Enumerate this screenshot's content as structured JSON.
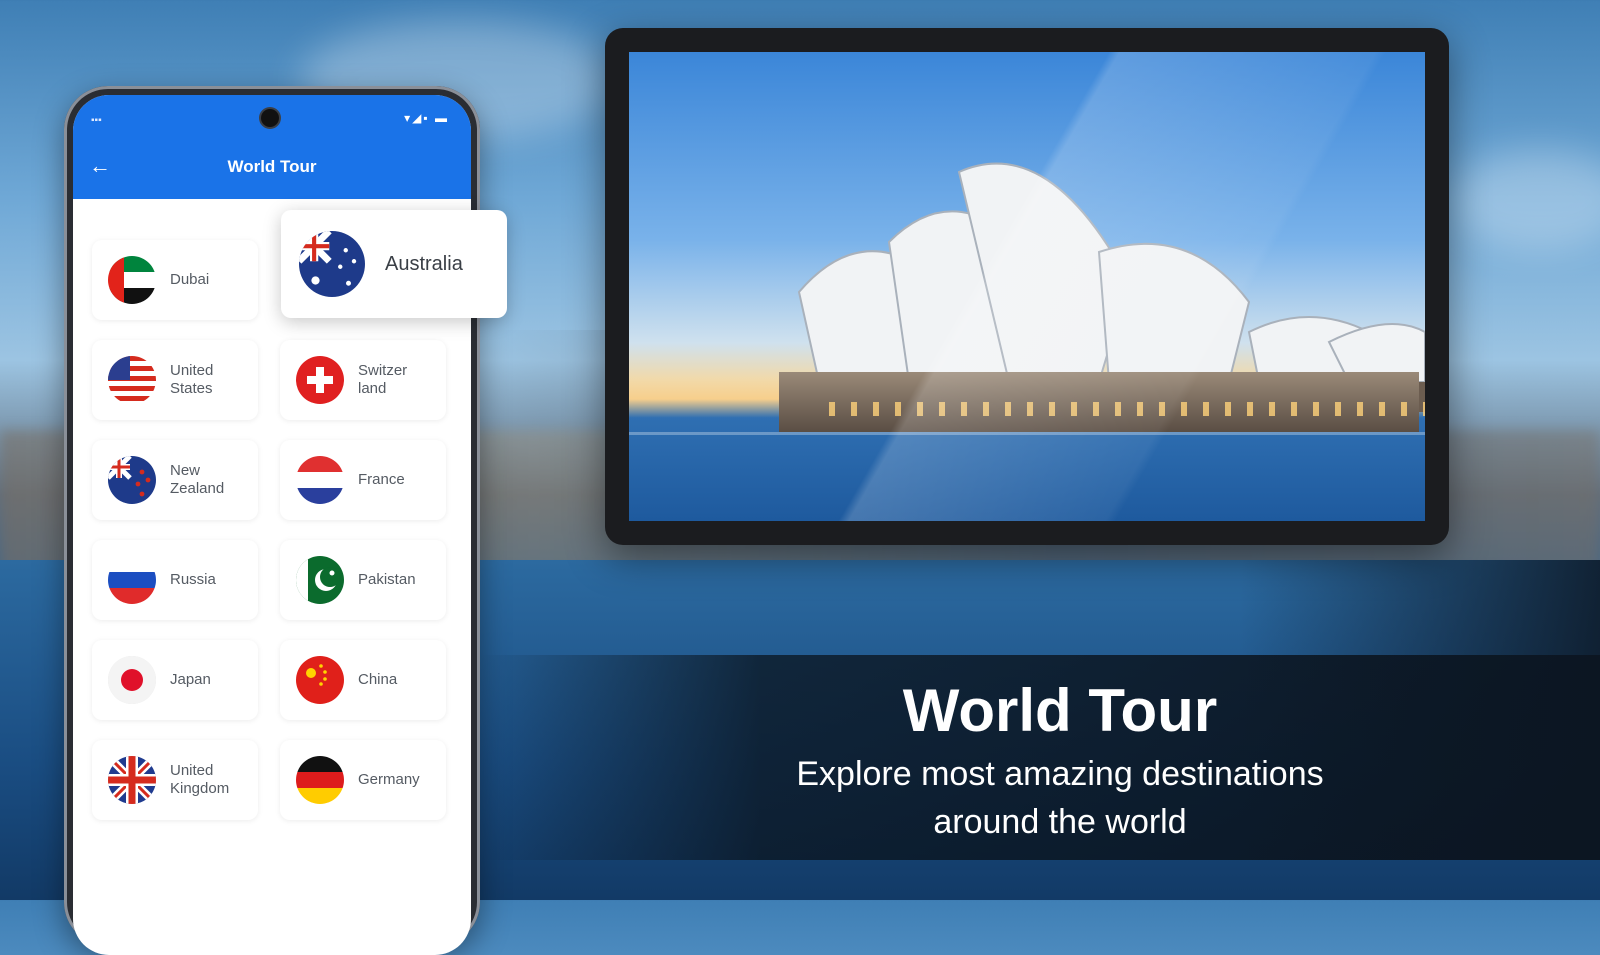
{
  "app": {
    "title": "World Tour",
    "status_left": "▪▪▪",
    "status_right": "▾◢▪ ▬",
    "back_icon": "←"
  },
  "countries": [
    {
      "name": "Dubai",
      "flag": "uae-flag-icon"
    },
    {
      "name": "Australia",
      "flag": "australia-flag-icon"
    },
    {
      "name": "United States",
      "flag": "usa-flag-icon"
    },
    {
      "name": "Switzer land",
      "flag": "switzerland-flag-icon"
    },
    {
      "name": "New Zealand",
      "flag": "new-zealand-flag-icon"
    },
    {
      "name": "France",
      "flag": "france-flag-icon"
    },
    {
      "name": "Russia",
      "flag": "russia-flag-icon"
    },
    {
      "name": "Pakistan",
      "flag": "pakistan-flag-icon"
    },
    {
      "name": "Japan",
      "flag": "japan-flag-icon"
    },
    {
      "name": "China",
      "flag": "china-flag-icon"
    },
    {
      "name": "United Kingdom",
      "flag": "uk-flag-icon"
    },
    {
      "name": "Germany",
      "flag": "germany-flag-icon"
    }
  ],
  "promo": {
    "title": "World Tour",
    "subtitle_line1": "Explore most amazing destinations",
    "subtitle_line2": "around the world"
  },
  "colors": {
    "appbar": "#1a73e8",
    "card_text": "#555b63"
  }
}
